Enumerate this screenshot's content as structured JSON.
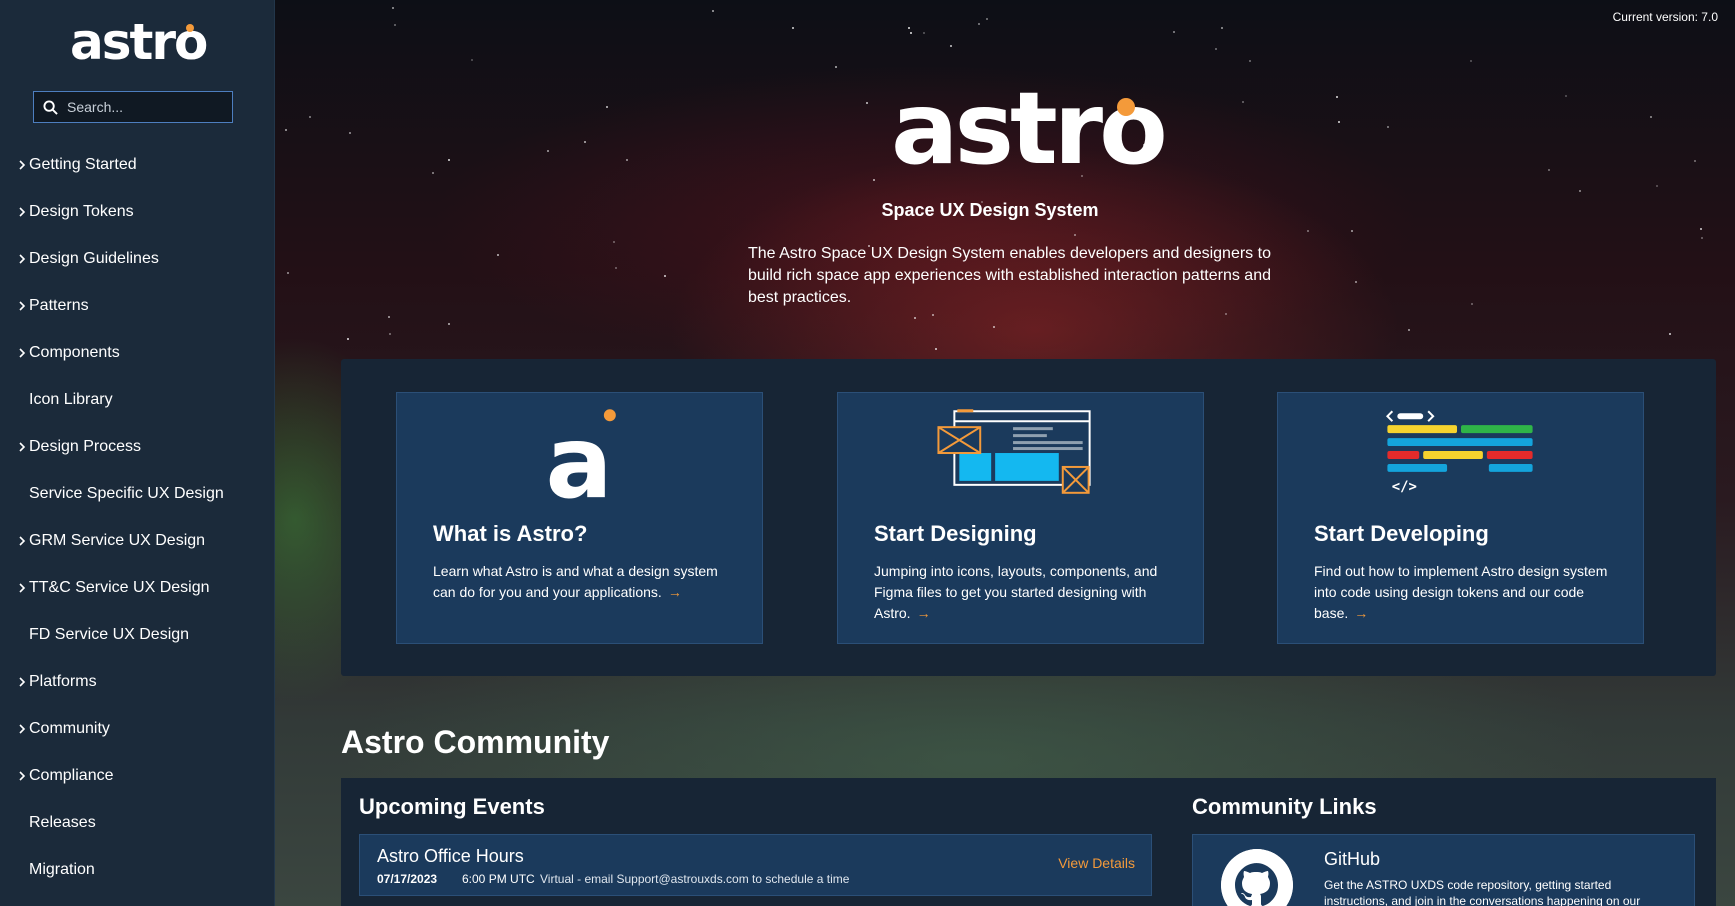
{
  "version_label": "Current version: 7.0",
  "brand": {
    "logo_text": "astro",
    "accent": "#f49a3a"
  },
  "search": {
    "placeholder": "Search..."
  },
  "sidebar": {
    "items": [
      {
        "label": "Getting Started",
        "expandable": true
      },
      {
        "label": "Design Tokens",
        "expandable": true
      },
      {
        "label": "Design Guidelines",
        "expandable": true
      },
      {
        "label": "Patterns",
        "expandable": true
      },
      {
        "label": "Components",
        "expandable": true
      },
      {
        "label": "Icon Library",
        "expandable": false
      },
      {
        "label": "Design Process",
        "expandable": true
      },
      {
        "label": "Service Specific UX Design",
        "expandable": false
      },
      {
        "label": "GRM Service UX Design",
        "expandable": true
      },
      {
        "label": "TT&C Service UX Design",
        "expandable": true
      },
      {
        "label": "FD Service UX Design",
        "expandable": false
      },
      {
        "label": "Platforms",
        "expandable": true
      },
      {
        "label": "Community",
        "expandable": true
      },
      {
        "label": "Compliance",
        "expandable": true
      },
      {
        "label": "Releases",
        "expandable": false
      },
      {
        "label": "Migration",
        "expandable": false
      }
    ]
  },
  "hero": {
    "logo_text": "astro",
    "subtitle": "Space UX Design System",
    "description": "The Astro Space UX Design System enables developers and designers to build rich space app experiences with established interaction patterns and best practices."
  },
  "cards": [
    {
      "title": "What is Astro?",
      "text": "Learn what Astro is and what a design system can do for you and your applications.",
      "icon": "astro-a-icon",
      "arrow": "→"
    },
    {
      "title": "Start Designing",
      "text": "Jumping into icons, layouts, components, and Figma files to get you started designing with Astro.",
      "icon": "design-layout-icon",
      "arrow": "→"
    },
    {
      "title": "Start Developing",
      "text": "Find out how to implement Astro design system into code using design tokens and our code base.",
      "icon": "code-icon",
      "arrow": "→"
    }
  ],
  "community": {
    "title": "Astro Community",
    "events_title": "Upcoming Events",
    "events": [
      {
        "name": "Astro Office Hours",
        "date": "07/17/2023",
        "time": "6:00 PM UTC",
        "location": "Virtual - email Support@astrouxds.com to schedule a time",
        "action": "View Details"
      }
    ],
    "links_title": "Community Links",
    "links": [
      {
        "name": "GitHub",
        "description": "Get the ASTRO UXDS code repository, getting started instructions, and join in the conversations happening on our",
        "icon": "github-icon"
      }
    ]
  }
}
